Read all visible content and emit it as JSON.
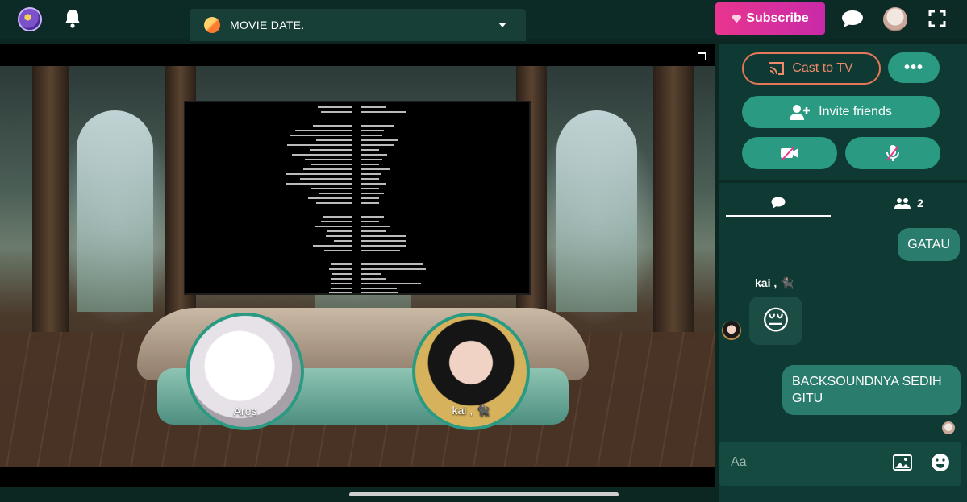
{
  "header": {
    "room_title": "MOVIE DATE.",
    "subscribe_label": "Subscribe"
  },
  "stage": {
    "participants": [
      {
        "name": "Ares"
      },
      {
        "name": "kai , 🐈‍⬛"
      }
    ]
  },
  "panel": {
    "cast_label": "Cast to TV",
    "more_label": "•••",
    "invite_label": "Invite friends",
    "people_count": "2",
    "messages": [
      {
        "text": "GATAU"
      },
      {
        "sender": "kai , 🐈‍⬛",
        "emoji": "😔"
      },
      {
        "text": "BACKSOUNDNYA SEDIH GITU"
      }
    ],
    "composer_placeholder": "Aa"
  },
  "colors": {
    "accent": "#2a9a82",
    "subscribe": "#e8358f",
    "cast_outline": "#e6785a",
    "panel_bg": "#0f3a33"
  }
}
